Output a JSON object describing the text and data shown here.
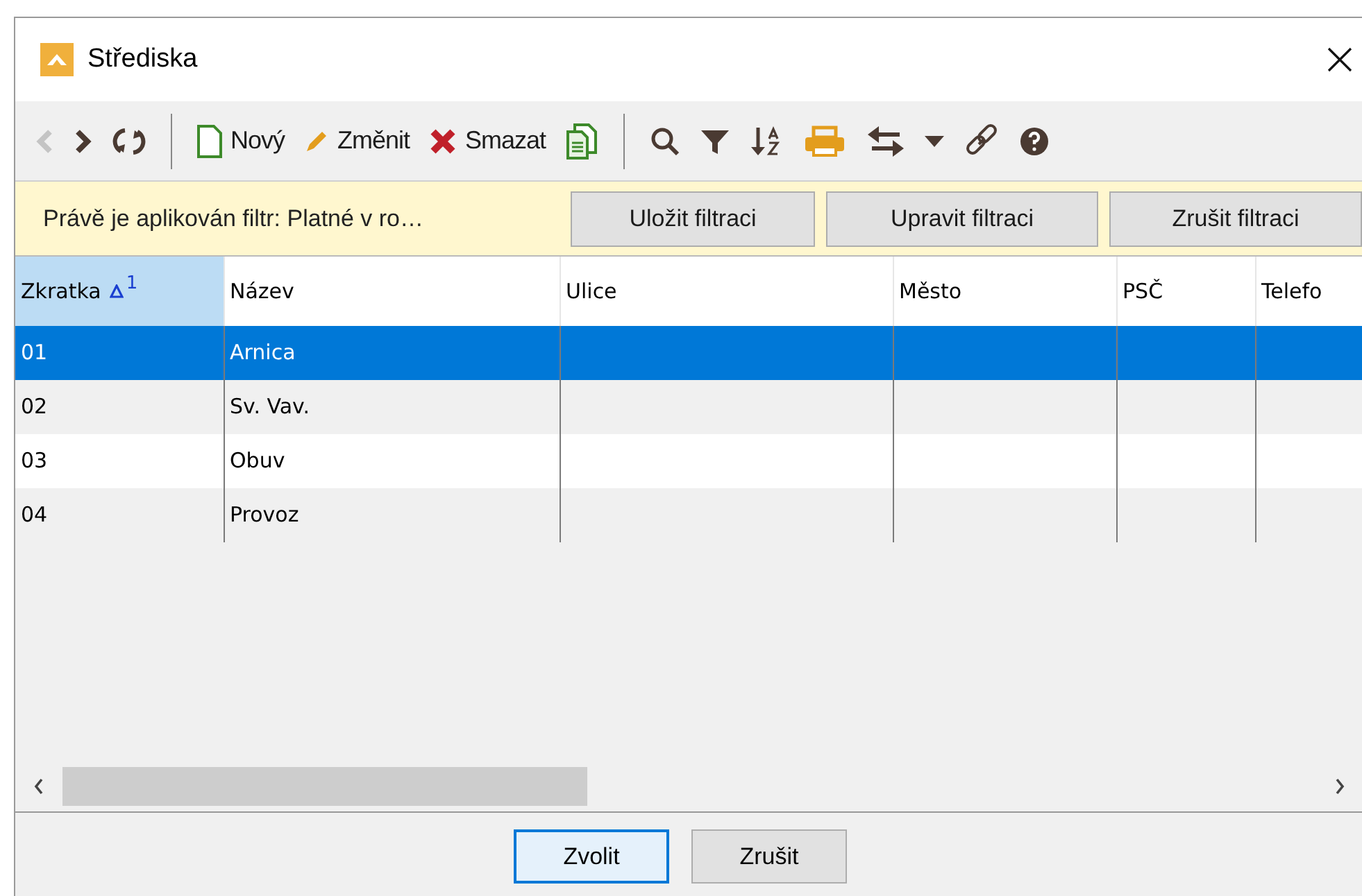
{
  "window": {
    "title": "Střediska"
  },
  "toolbar": [
    {
      "kind": "icon",
      "disabled": true
    },
    {
      "kind": "icon",
      "disabled": false
    },
    {
      "kind": "icon",
      "disabled": false
    },
    {
      "kind": "separator"
    },
    {
      "kind": "button",
      "label": "Nový"
    },
    {
      "kind": "button",
      "label": "Změnit"
    },
    {
      "kind": "button",
      "label": "Smazat"
    },
    {
      "kind": "icon",
      "disabled": false
    },
    {
      "kind": "separator"
    },
    {
      "kind": "icon",
      "disabled": false
    },
    {
      "kind": "icon",
      "disabled": false
    },
    {
      "kind": "icon",
      "disabled": false
    },
    {
      "kind": "icon",
      "disabled": false
    },
    {
      "kind": "icon",
      "disabled": false
    },
    {
      "kind": "icon",
      "disabled": false
    },
    {
      "kind": "icon",
      "disabled": false
    },
    {
      "kind": "icon",
      "disabled": false
    }
  ],
  "filter_bar": {
    "message": "Právě je aplikován filtr: Platné v ro…",
    "buttons": [
      "Uložit filtraci",
      "Upravit filtraci",
      "Zrušit filtraci"
    ]
  },
  "table": {
    "columns": [
      {
        "label": "Zkratka",
        "sorted": true,
        "sort_index": "1"
      },
      {
        "label": "Název",
        "sorted": false
      },
      {
        "label": "Ulice",
        "sorted": false
      },
      {
        "label": "Město",
        "sorted": false
      },
      {
        "label": "PSČ",
        "sorted": false
      },
      {
        "label": "Telefo",
        "sorted": false
      }
    ],
    "rows": [
      {
        "cells": [
          "01",
          "Arnica",
          "",
          "",
          "",
          ""
        ],
        "selected": true
      },
      {
        "cells": [
          "02",
          "Sv. Vav.",
          "",
          "",
          "",
          ""
        ],
        "selected": false
      },
      {
        "cells": [
          "03",
          "Obuv",
          "",
          "",
          "",
          ""
        ],
        "selected": false
      },
      {
        "cells": [
          "04",
          "Provoz",
          "",
          "",
          "",
          ""
        ],
        "selected": false
      }
    ]
  },
  "buttons": [
    {
      "label": "Zvolit",
      "default": true
    },
    {
      "label": "Zrušit",
      "default": false
    }
  ]
}
